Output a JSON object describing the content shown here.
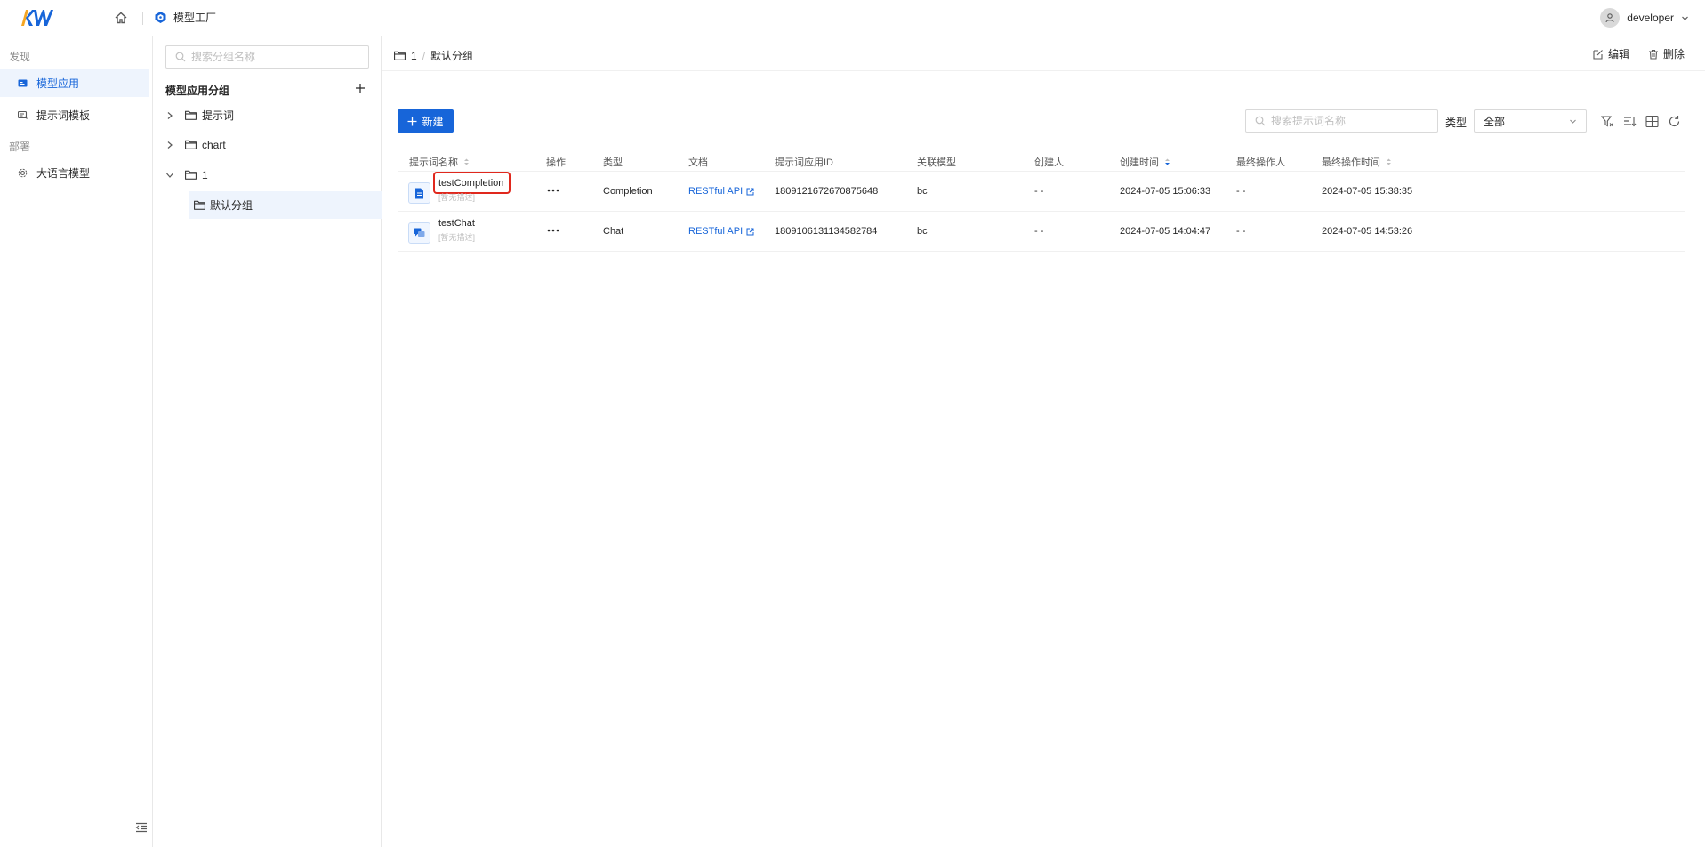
{
  "topbar": {
    "logo_text": "KW",
    "app_name": "模型工厂",
    "username": "developer"
  },
  "leftnav": {
    "groups": [
      {
        "label": "发现"
      },
      {
        "label": "部署"
      }
    ],
    "items": [
      {
        "label": "模型应用",
        "icon": "model-app-icon",
        "active": true
      },
      {
        "label": "提示词模板",
        "icon": "prompt-template-icon",
        "active": false
      },
      {
        "label": "大语言模型",
        "icon": "llm-icon",
        "active": false
      }
    ]
  },
  "grouppanel": {
    "search_placeholder": "搜索分组名称",
    "title": "模型应用分组",
    "tree": [
      {
        "label": "提示词",
        "expanded": false
      },
      {
        "label": "chart",
        "expanded": false
      },
      {
        "label": "1",
        "expanded": true
      },
      {
        "label": "默认分组",
        "selected": true
      }
    ]
  },
  "main": {
    "breadcrumb": {
      "parent": "1",
      "sep": "/",
      "current": "默认分组"
    },
    "actions": {
      "edit": "编辑",
      "delete": "删除"
    },
    "new_button": "新建",
    "search_placeholder": "搜索提示词名称",
    "type_label": "类型",
    "type_value": "全部",
    "columns": {
      "name": "提示词名称",
      "ops": "操作",
      "type": "类型",
      "docs": "文档",
      "app_id": "提示词应用ID",
      "model": "关联模型",
      "creator": "创建人",
      "created": "创建时间",
      "last_operator": "最终操作人",
      "last_time": "最终操作时间"
    },
    "rows": [
      {
        "name": "testCompletion",
        "desc": "[暂无描述]",
        "icon": "document-icon",
        "type": "Completion",
        "docs": "RESTful API",
        "app_id": "1809121672670875648",
        "model": "bc",
        "creator": "- -",
        "created": "2024-07-05 15:06:33",
        "last_operator": "- -",
        "last_time": "2024-07-05 15:38:35",
        "highlighted": true
      },
      {
        "name": "testChat",
        "desc": "[暂无描述]",
        "icon": "chat-icon",
        "type": "Chat",
        "docs": "RESTful API",
        "app_id": "1809106131134582784",
        "model": "bc",
        "creator": "- -",
        "created": "2024-07-05 14:04:47",
        "last_operator": "- -",
        "last_time": "2024-07-05 14:53:26",
        "highlighted": false
      }
    ]
  },
  "colors": {
    "primary": "#1765d9",
    "highlight": "#e0281d",
    "active_bg": "#eef4fd",
    "logo_orange": "#f5a623"
  }
}
